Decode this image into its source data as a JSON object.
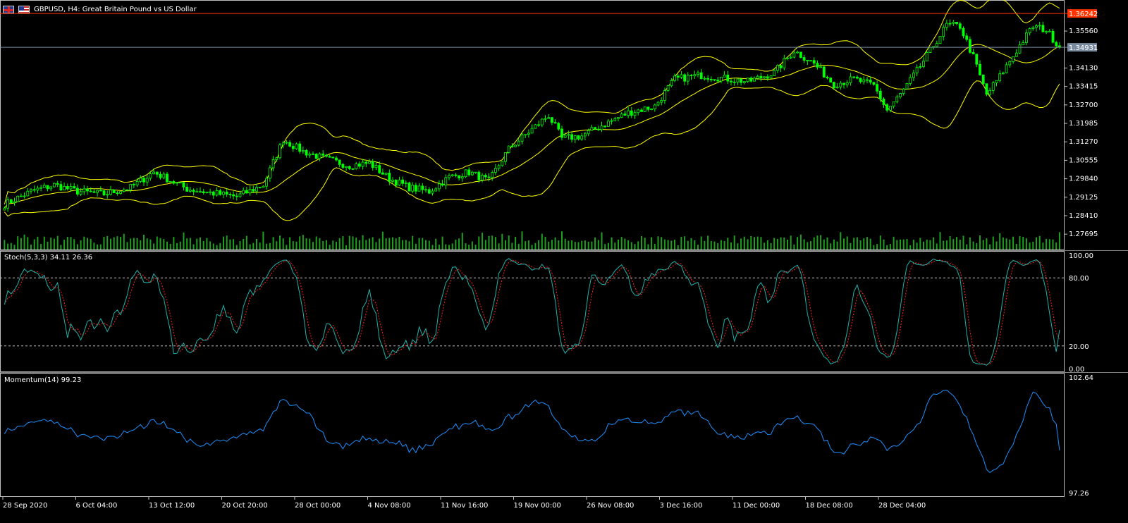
{
  "title": {
    "symbol_text": "GBPUSD, H4:  Great Britain Pound vs US Dollar",
    "flag_base": "flag-gb-icon",
    "flag_quote": "flag-us-icon"
  },
  "colors": {
    "background": "#000000",
    "candle_body": "#00ff00",
    "bollinger": "#ffff00",
    "volume": "#1fa01f",
    "stoch_main": "#20b2aa",
    "stoch_signal": "#ff2020",
    "momentum": "#1e90ff",
    "high_line": "#ff3300",
    "bid_line": "#7a8ba0",
    "axis_text": "#ffffff",
    "separator": "#c0c0c0"
  },
  "price_pane": {
    "y_ticks": [
      "1.35560",
      "1.34130",
      "1.33415",
      "1.32700",
      "1.31985",
      "1.31270",
      "1.30555",
      "1.29840",
      "1.29125",
      "1.28410",
      "1.27695"
    ],
    "high_marker_label": "1.36242",
    "bid_marker_label": "1.34931"
  },
  "stoch_pane": {
    "label": "Stoch(5,3,3) 34.11 26.36",
    "y_ticks": [
      "100.00",
      "80.00",
      "20.00",
      "0.00"
    ]
  },
  "momentum_pane": {
    "label": "Momentum(14) 99.23",
    "y_ticks": [
      "102.64",
      "97.26"
    ]
  },
  "time_axis": {
    "labels": [
      "28 Sep 2020",
      "6 Oct 04:00",
      "13 Oct 12:00",
      "20 Oct 20:00",
      "28 Oct 00:00",
      "4 Nov 08:00",
      "11 Nov 16:00",
      "19 Nov 00:00",
      "26 Nov 08:00",
      "3 Dec 16:00",
      "11 Dec 00:00",
      "18 Dec 08:00",
      "28 Dec 04:00"
    ]
  },
  "chart_data": {
    "type": "candlestick",
    "symbol": "GBPUSD",
    "timeframe": "H4",
    "price_range": [
      1.271,
      1.366
    ],
    "price_close_anchors": [
      [
        0,
        1.2885
      ],
      [
        8,
        1.2935
      ],
      [
        15,
        1.296
      ],
      [
        22,
        1.2935
      ],
      [
        30,
        1.2925
      ],
      [
        38,
        1.295
      ],
      [
        45,
        1.301
      ],
      [
        55,
        1.2945
      ],
      [
        62,
        1.293
      ],
      [
        70,
        1.2915
      ],
      [
        78,
        1.296
      ],
      [
        84,
        1.3135
      ],
      [
        90,
        1.309
      ],
      [
        97,
        1.306
      ],
      [
        104,
        1.3035
      ],
      [
        110,
        1.3045
      ],
      [
        116,
        1.2985
      ],
      [
        122,
        1.295
      ],
      [
        128,
        1.2935
      ],
      [
        134,
        1.299
      ],
      [
        140,
        1.301
      ],
      [
        146,
        1.2975
      ],
      [
        152,
        1.31
      ],
      [
        158,
        1.3165
      ],
      [
        164,
        1.323
      ],
      [
        168,
        1.314
      ],
      [
        174,
        1.315
      ],
      [
        180,
        1.319
      ],
      [
        188,
        1.324
      ],
      [
        196,
        1.3265
      ],
      [
        202,
        1.337
      ],
      [
        210,
        1.3385
      ],
      [
        216,
        1.3375
      ],
      [
        224,
        1.336
      ],
      [
        232,
        1.3395
      ],
      [
        238,
        1.348
      ],
      [
        244,
        1.343
      ],
      [
        250,
        1.335
      ],
      [
        256,
        1.337
      ],
      [
        262,
        1.3345
      ],
      [
        266,
        1.325
      ],
      [
        270,
        1.331
      ],
      [
        276,
        1.342
      ],
      [
        284,
        1.358
      ],
      [
        288,
        1.3575
      ],
      [
        292,
        1.3455
      ],
      [
        296,
        1.331
      ],
      [
        300,
        1.338
      ],
      [
        306,
        1.35
      ],
      [
        310,
        1.3575
      ],
      [
        314,
        1.356
      ],
      [
        318,
        1.3493
      ]
    ],
    "volatility": 0.0018,
    "last_close": 1.34931,
    "period_high": 1.36242,
    "stochastic": {
      "k_period": 5,
      "d_period": 3,
      "slowing": 3,
      "last_main": 34.11,
      "last_signal": 26.36,
      "levels": [
        20,
        80
      ],
      "range": [
        0,
        100
      ]
    },
    "momentum": {
      "period": 14,
      "last": 99.23,
      "range": [
        97.26,
        102.64
      ]
    }
  }
}
